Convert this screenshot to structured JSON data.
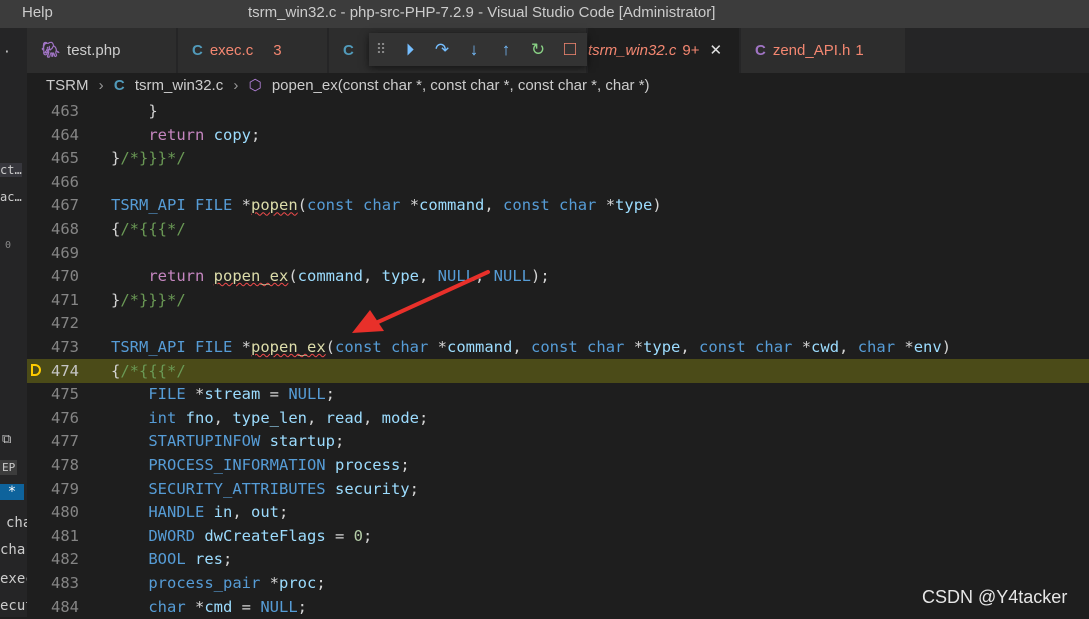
{
  "titlebar": {
    "menu_help": "Help",
    "title": "tsrm_win32.c - php-src-PHP-7.2.9 - Visual Studio Code [Administrator]"
  },
  "sidebar": {
    "fragments": [
      "·",
      "ct…",
      "ac…",
      "0",
      "EP",
      "*",
      "cha",
      "char",
      "exec",
      "ecut"
    ]
  },
  "tabs": [
    {
      "icon": "php-elephant-icon",
      "label": "test.php",
      "badge": ""
    },
    {
      "icon": "c-file-icon",
      "label": "exec.c",
      "badge": "3"
    },
    {
      "icon": "c-file-icon",
      "label": "",
      "badge": ""
    },
    {
      "icon": "c-file-icon",
      "label": "tsrm_win32.c",
      "badge": "9+"
    },
    {
      "icon": "h-file-icon",
      "label": "zend_API.h",
      "badge": "1"
    }
  ],
  "tab_close": "✕",
  "debug_toolbar": {
    "icons": [
      "drag-handle-icon",
      "continue-icon",
      "step-over-icon",
      "step-into-icon",
      "step-out-icon",
      "restart-icon",
      "stop-icon"
    ],
    "glyphs": [
      "⠿",
      "⏵",
      "↷",
      "↓",
      "↑",
      "↻",
      "□"
    ]
  },
  "breadcrumb": {
    "folder": "TSRM",
    "file_icon": "C",
    "file": "tsrm_win32.c",
    "symbol": "popen_ex(const char *, const char *, const char *, char *)"
  },
  "editor": {
    "current_line": 474,
    "breakpoint_line": 474,
    "lines": [
      {
        "n": 463,
        "code": "    }"
      },
      {
        "n": 464,
        "code": "    return copy;"
      },
      {
        "n": 465,
        "code": "}/*}}}*/"
      },
      {
        "n": 466,
        "code": ""
      },
      {
        "n": 467,
        "code": "TSRM_API FILE *popen(const char *command, const char *type)"
      },
      {
        "n": 468,
        "code": "{/*{{{*/"
      },
      {
        "n": 469,
        "code": ""
      },
      {
        "n": 470,
        "code": "    return popen_ex(command, type, NULL, NULL);"
      },
      {
        "n": 471,
        "code": "}/*}}}*/"
      },
      {
        "n": 472,
        "code": ""
      },
      {
        "n": 473,
        "code": "TSRM_API FILE *popen_ex(const char *command, const char *type, const char *cwd, char *env)"
      },
      {
        "n": 474,
        "code": "{/*{{{*/"
      },
      {
        "n": 475,
        "code": "    FILE *stream = NULL;"
      },
      {
        "n": 476,
        "code": "    int fno, type_len, read, mode;"
      },
      {
        "n": 477,
        "code": "    STARTUPINFOW startup;"
      },
      {
        "n": 478,
        "code": "    PROCESS_INFORMATION process;"
      },
      {
        "n": 479,
        "code": "    SECURITY_ATTRIBUTES security;"
      },
      {
        "n": 480,
        "code": "    HANDLE in, out;"
      },
      {
        "n": 481,
        "code": "    DWORD dwCreateFlags = 0;"
      },
      {
        "n": 482,
        "code": "    BOOL res;"
      },
      {
        "n": 483,
        "code": "    process_pair *proc;"
      },
      {
        "n": 484,
        "code": "    char *cmd = NULL;"
      }
    ]
  },
  "annotation": {
    "type": "red-arrow"
  },
  "watermark": "CSDN @Y4tacker",
  "colors": {
    "accent_error": "#f48771",
    "highlight_line": "#4b4b18",
    "arrow": "#e8302a",
    "breakpoint": "#ffcc00"
  }
}
